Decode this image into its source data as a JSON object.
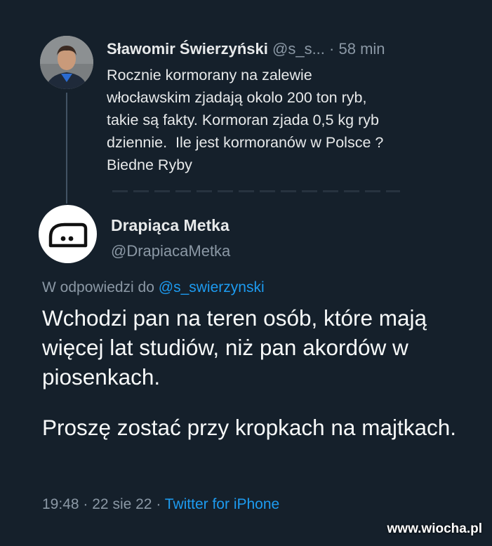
{
  "quoted_tweet": {
    "author_name": "Sławomir Świerzyński",
    "handle": "@s_s...",
    "separator": "·",
    "time": "58 min",
    "text_lines": [
      "Rocznie kormorany na zalewie",
      "włocławskim zjadają okolo 200 ton ryb,",
      "takie są fakty. Kormoran zjada 0,5 kg ryb",
      "dziennie.  Ile jest kormoranów w Polsce ?",
      "Biedne Ryby"
    ]
  },
  "reply_tweet": {
    "author_name": "Drapiąca Metka",
    "handle": "@DrapiacaMetka",
    "reply_prefix": "W odpowiedzi do",
    "reply_target": "@s_swierzynski",
    "paragraphs": [
      "Wchodzi pan na teren osób, które mają więcej lat studiów, niż pan akordów w piosenkach.",
      "Proszę zostać przy kropkach na majtkach."
    ],
    "time": "19:48",
    "date": "22 sie 22",
    "separator": "·",
    "source": "Twitter for iPhone"
  },
  "watermark": "www.wiocha.pl",
  "colors": {
    "background": "#15202b",
    "primary_text": "#e7e9ea",
    "secondary_text": "#8b98a5",
    "link": "#1d9bf0"
  },
  "icons": {
    "reply_avatar": "iron-icon"
  }
}
